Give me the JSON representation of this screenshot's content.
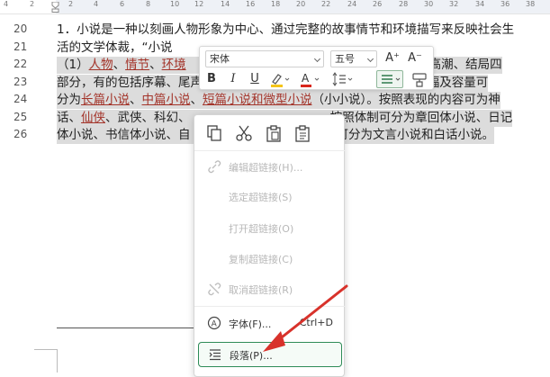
{
  "ruler": {
    "numbers": [
      "4",
      "2",
      "2",
      "4",
      "6",
      "8",
      "10",
      "12",
      "14",
      "16",
      "18",
      "20",
      "22",
      "24",
      "26",
      "28",
      "30",
      "32",
      "34",
      "36",
      "38"
    ]
  },
  "lines": [
    {
      "num": "20",
      "parts": [
        {
          "t": "1．小说是一种以刻画人物形象为中心、通过完整的故事情节和环境描写来反映社会生"
        }
      ]
    },
    {
      "num": "21",
      "parts": [
        {
          "t": "活的文学体裁，“小说"
        }
      ]
    },
    {
      "num": "22",
      "parts": [
        {
          "t": "（1）"
        },
        {
          "t": "人物",
          "link": true
        },
        {
          "t": "、"
        },
        {
          "t": "情节",
          "link": true
        },
        {
          "t": "、"
        },
        {
          "t": "环境",
          "link": true
        },
        {
          "t": "　　　　　　　　　　　　　　　　　发展、高潮、结局四"
        }
      ]
    },
    {
      "num": "23",
      "parts": [
        {
          "t": "部分，有的包括序幕、尾声。　　　　　　　　　　　　　　说按照篇幅及容量可"
        }
      ]
    },
    {
      "num": "24",
      "parts": [
        {
          "t": "分为"
        },
        {
          "t": "长篇小说",
          "link": true
        },
        {
          "t": "、"
        },
        {
          "t": "中篇小说",
          "link": true
        },
        {
          "t": "、"
        },
        {
          "t": "短篇小说和微型小说",
          "link": true
        },
        {
          "t": "（小小说）。按照表现的内容可为神"
        }
      ]
    },
    {
      "num": "25",
      "parts": [
        {
          "t": "话、"
        },
        {
          "t": "仙侠",
          "link": true
        },
        {
          "t": "、武侠、科幻、　　　　　　　　　　　　按照体制可分为章回体小说、日记"
        }
      ]
    },
    {
      "num": "26",
      "parts": [
        {
          "t": "体小说、书信体小说、自　　　　　　　　　　　　可分为文言小说和白话小说。"
        }
      ]
    }
  ],
  "toolbar": {
    "font_name": "宋体",
    "font_size": "五号",
    "grow_font": "A⁺",
    "shrink_font": "A⁻",
    "bold": "B",
    "italic": "I",
    "underline": "U",
    "highlight": "✎",
    "font_color": "A",
    "line_spacing": "↕",
    "colors": {
      "highlight": "#f5c518",
      "font_color": "#d9261c",
      "accent": "#2e8b57"
    }
  },
  "context_menu": {
    "items": [
      {
        "label": "编辑超链接(H)...",
        "disabled": true
      },
      {
        "label": "选定超链接(S)",
        "disabled": true
      },
      {
        "label": "打开超链接(O)",
        "disabled": true
      },
      {
        "label": "复制超链接(C)",
        "disabled": true
      },
      {
        "label": "取消超链接(R)",
        "disabled": true
      },
      {
        "label": "字体(F)...",
        "shortcut": "Ctrl+D",
        "disabled": false
      },
      {
        "label": "段落(P)...",
        "disabled": false,
        "highlighted": true
      }
    ]
  }
}
